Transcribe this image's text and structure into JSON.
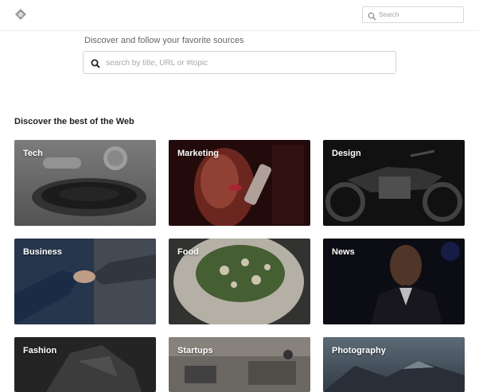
{
  "header": {
    "logo_icon": "feedly-logo-icon",
    "search": {
      "placeholder": "Search",
      "icon": "search-icon"
    }
  },
  "discover": {
    "tagline": "Discover and follow your favorite sources",
    "search_placeholder": "search by title, URL or #topic",
    "search_icon": "search-icon"
  },
  "section_title": "Discover the best of the Web",
  "categories": [
    {
      "label": "Tech"
    },
    {
      "label": "Marketing"
    },
    {
      "label": "Design"
    },
    {
      "label": "Business"
    },
    {
      "label": "Food"
    },
    {
      "label": "News"
    },
    {
      "label": "Fashion"
    },
    {
      "label": "Startups"
    },
    {
      "label": "Photography"
    }
  ]
}
